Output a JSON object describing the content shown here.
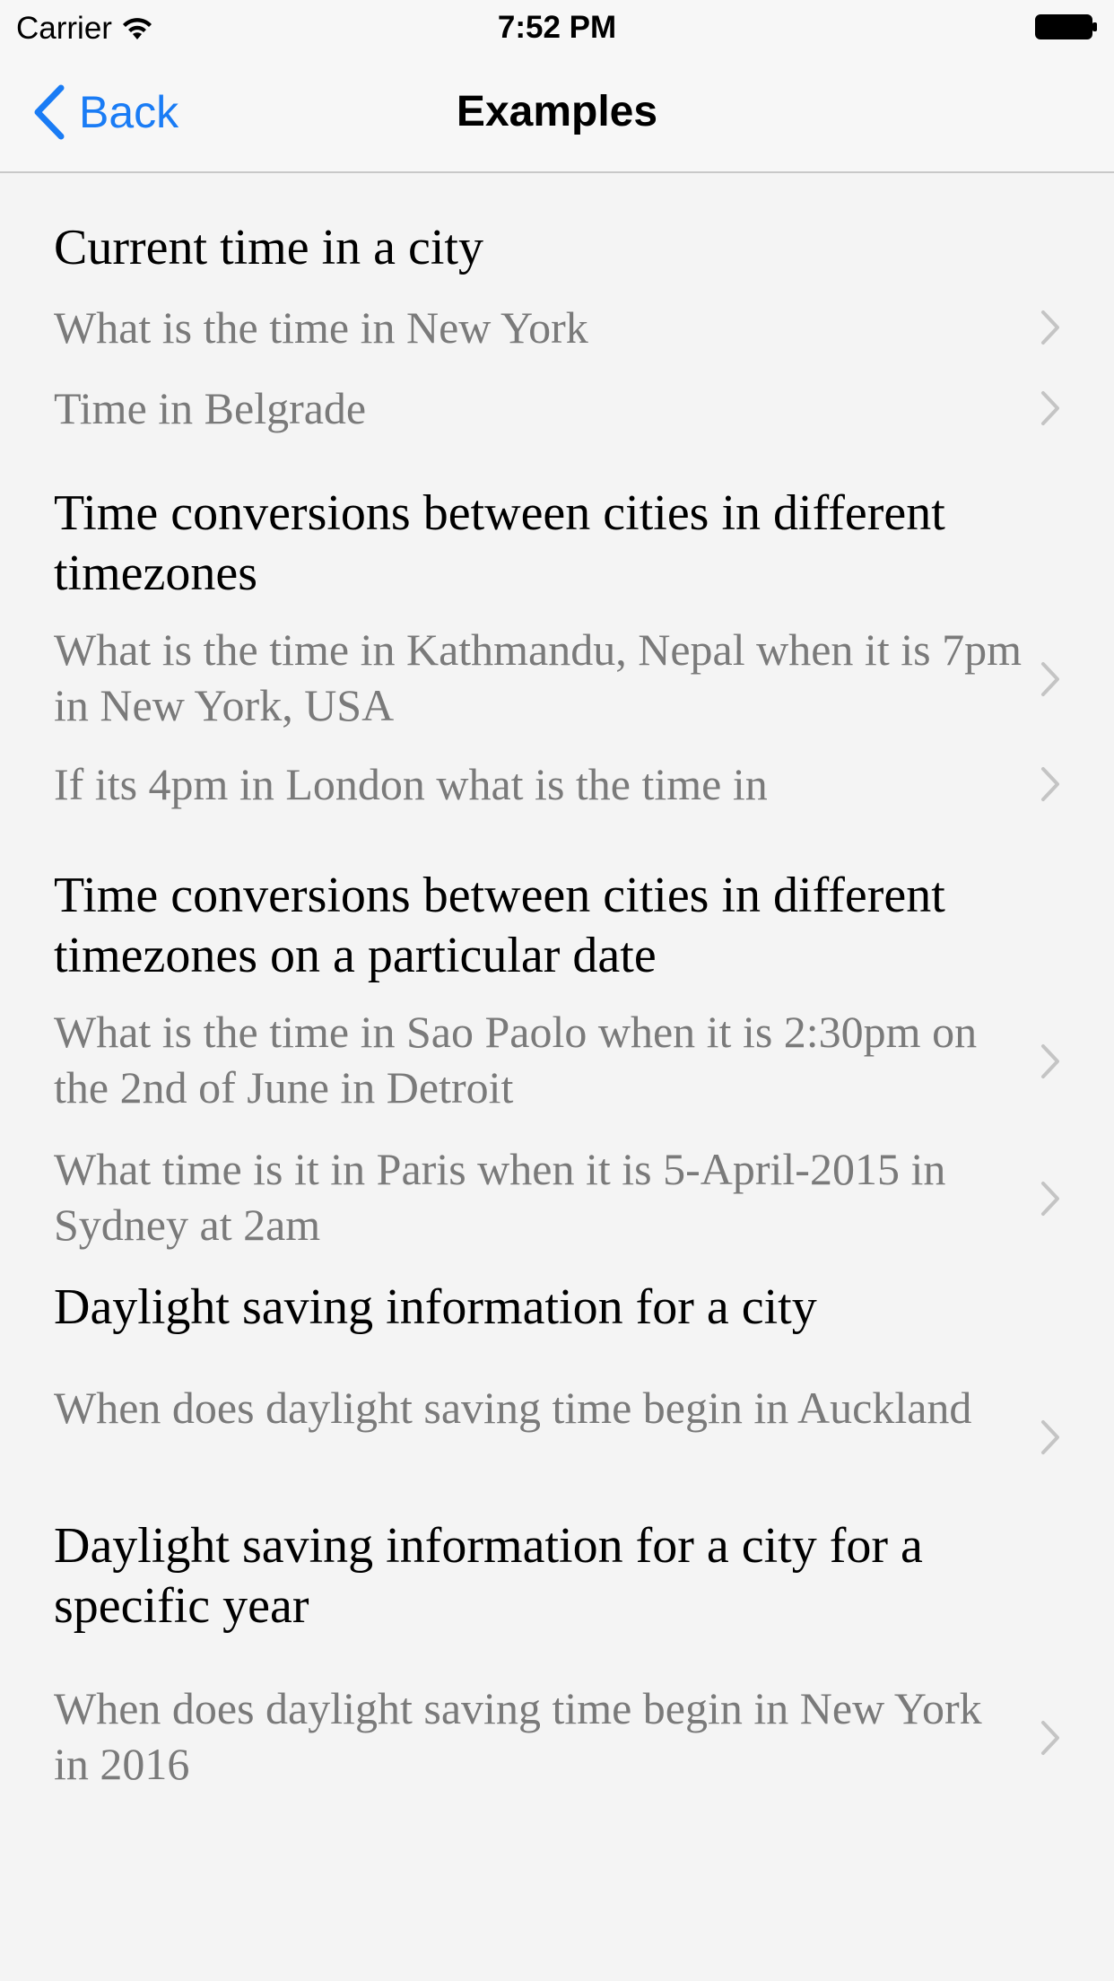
{
  "status_bar": {
    "carrier": "Carrier",
    "time": "7:52 PM",
    "icons": [
      "wifi-icon",
      "battery-icon"
    ]
  },
  "nav": {
    "back_label": "Back",
    "title": "Examples",
    "accent_color": "#1a7cf5"
  },
  "sections": [
    {
      "header": "Current time in a city",
      "items": [
        "What is the time in New York",
        "Time in Belgrade"
      ]
    },
    {
      "header": "Time conversions between cities in different timezones",
      "items": [
        "What is the time in Kathmandu, Nepal when it is 7pm in New York, USA",
        "If its 4pm in London what is the time in"
      ]
    },
    {
      "header": "Time conversions between cities in different timezones on a particular date",
      "items": [
        "What is the time in Sao Paolo when it is 2:30pm on the 2nd of June in Detroit",
        "What time is it in Paris when it is 5-April-2015 in Sydney at 2am"
      ]
    },
    {
      "header": "Daylight saving information for a city",
      "items": [
        "When does daylight saving time begin in Auckland"
      ]
    },
    {
      "header": "Daylight saving information for a city for a specific year",
      "items": [
        "When does daylight saving time begin in New York in 2016"
      ]
    }
  ]
}
